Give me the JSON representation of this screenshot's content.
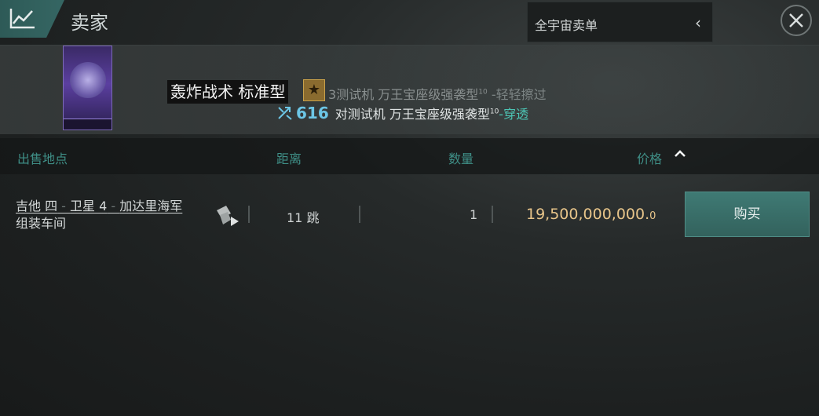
{
  "header": {
    "title": "卖家",
    "market_selector": {
      "label": "全宇宙卖单"
    }
  },
  "item": {
    "name": "轰炸战术 标准型",
    "rank_glyph": "★",
    "effect_1": {
      "prefix": "3",
      "target": "测试机 万王宝座级强袭型",
      "level": "10",
      "result": "-轻轻擦过"
    },
    "effect_2": {
      "damage": "616",
      "target": "对测试机 万王宝座级强袭型",
      "level": "10",
      "result": "-穿透"
    }
  },
  "table": {
    "columns": {
      "location": "出售地点",
      "distance": "距离",
      "quantity": "数量",
      "price": "价格"
    },
    "sort": {
      "column": "price",
      "direction": "ascending"
    },
    "rows": [
      {
        "location_line1_a": "吉他 四",
        "location_line1_sep1": " - ",
        "location_line1_b": "卫星 4",
        "location_line1_sep2": " - ",
        "location_line1_c": "加达里海军",
        "location_line2": "组装车间",
        "distance": "11 跳",
        "quantity": "1",
        "price_main": "19,500,000,000.",
        "price_decimal": "0",
        "action": "购买"
      }
    ]
  },
  "colors": {
    "accent_teal": "#3f7a74",
    "price_gold": "#e8c58a",
    "header_text": "#3f8f87"
  }
}
